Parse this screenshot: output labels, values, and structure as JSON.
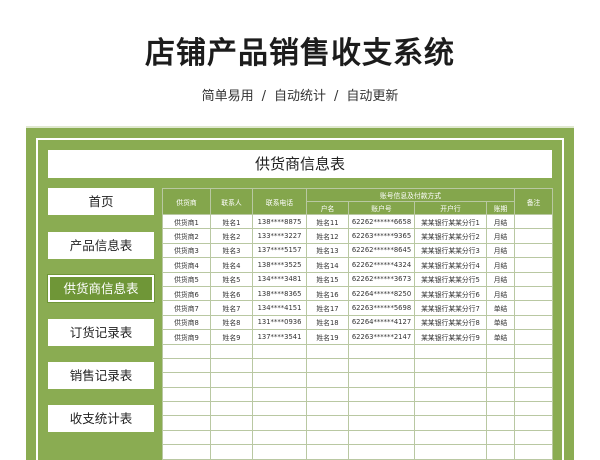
{
  "header": {
    "title": "店铺产品销售收支系统",
    "subtitle_parts": [
      "简单易用",
      "自动统计",
      "自动更新"
    ],
    "separator": "/"
  },
  "sheet": {
    "title": "供货商信息表"
  },
  "nav": {
    "items": [
      {
        "label": "首页"
      },
      {
        "label": "产品信息表"
      },
      {
        "label": "供货商信息表",
        "active": true
      },
      {
        "label": "订货记录表"
      },
      {
        "label": "销售记录表"
      },
      {
        "label": "收支统计表"
      }
    ]
  },
  "table": {
    "headers": {
      "supplier": "供货商",
      "contact": "联系人",
      "phone": "联系电话",
      "account_group": "账号信息及付款方式",
      "account_name": "户名",
      "account_no": "账户号",
      "bank": "开户行",
      "settlement": "账期",
      "remark": "备注"
    },
    "rows": [
      [
        "供货商1",
        "姓名1",
        "138****8875",
        "姓名11",
        "62262******6658",
        "某某银行某某分行1",
        "月结",
        ""
      ],
      [
        "供货商2",
        "姓名2",
        "133****3227",
        "姓名12",
        "62263******9365",
        "某某银行某某分行2",
        "月结",
        ""
      ],
      [
        "供货商3",
        "姓名3",
        "137****5157",
        "姓名13",
        "62262******8645",
        "某某银行某某分行3",
        "月结",
        ""
      ],
      [
        "供货商4",
        "姓名4",
        "138****3525",
        "姓名14",
        "62262******4324",
        "某某银行某某分行4",
        "月结",
        ""
      ],
      [
        "供货商5",
        "姓名5",
        "134****3481",
        "姓名15",
        "62262******3673",
        "某某银行某某分行5",
        "月结",
        ""
      ],
      [
        "供货商6",
        "姓名6",
        "138****8365",
        "姓名16",
        "62264******8250",
        "某某银行某某分行6",
        "月结",
        ""
      ],
      [
        "供货商7",
        "姓名7",
        "134****4151",
        "姓名17",
        "62263******5698",
        "某某银行某某分行7",
        "单结",
        ""
      ],
      [
        "供货商8",
        "姓名8",
        "131****0936",
        "姓名18",
        "62264******4127",
        "某某银行某某分行8",
        "单结",
        ""
      ],
      [
        "供货商9",
        "姓名9",
        "137****3541",
        "姓名19",
        "62263******2147",
        "某某银行某某分行9",
        "单结",
        ""
      ],
      [
        "",
        "",
        "",
        "",
        "",
        "",
        "",
        ""
      ],
      [
        "",
        "",
        "",
        "",
        "",
        "",
        "",
        ""
      ],
      [
        "",
        "",
        "",
        "",
        "",
        "",
        "",
        ""
      ],
      [
        "",
        "",
        "",
        "",
        "",
        "",
        "",
        ""
      ],
      [
        "",
        "",
        "",
        "",
        "",
        "",
        "",
        ""
      ],
      [
        "",
        "",
        "",
        "",
        "",
        "",
        "",
        ""
      ],
      [
        "",
        "",
        "",
        "",
        "",
        "",
        "",
        ""
      ],
      [
        "",
        "",
        "",
        "",
        "",
        "",
        "",
        ""
      ]
    ]
  },
  "colors": {
    "accent": "#8aac52",
    "header_bg": "#84a64c",
    "active_nav": "#6f9637"
  }
}
